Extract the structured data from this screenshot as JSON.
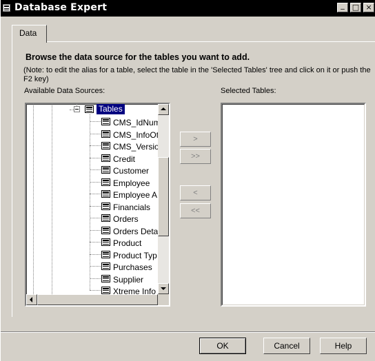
{
  "window": {
    "title": "Database Expert",
    "controls": {
      "minimize": "_",
      "maximize": "□",
      "close": "×"
    }
  },
  "tabs": [
    {
      "label": "Data",
      "active": true
    }
  ],
  "main": {
    "heading": "Browse the data source for the tables you want to add.",
    "note": "(Note: to edit the alias for a table, select the table in the 'Selected Tables' tree and click on it or push the F2 key)",
    "available_label": "Available Data Sources:",
    "selected_label": "Selected Tables:"
  },
  "tree": {
    "root_label": "Tables",
    "items": [
      "CMS_IdNum",
      "CMS_InfoOt",
      "CMS_Versio",
      "Credit",
      "Customer",
      "Employee",
      "Employee A",
      "Financials",
      "Orders",
      "Orders Deta",
      "Product",
      "Product Typ",
      "Purchases",
      "Supplier",
      "Xtreme Info"
    ]
  },
  "move_buttons": {
    "add": ">",
    "add_all": ">>",
    "remove": "<",
    "remove_all": "<<"
  },
  "footer": {
    "ok": "OK",
    "cancel": "Cancel",
    "help": "Help"
  },
  "colors": {
    "titlebar": "#000000",
    "selection": "#000080",
    "face": "#d4d0c8"
  }
}
